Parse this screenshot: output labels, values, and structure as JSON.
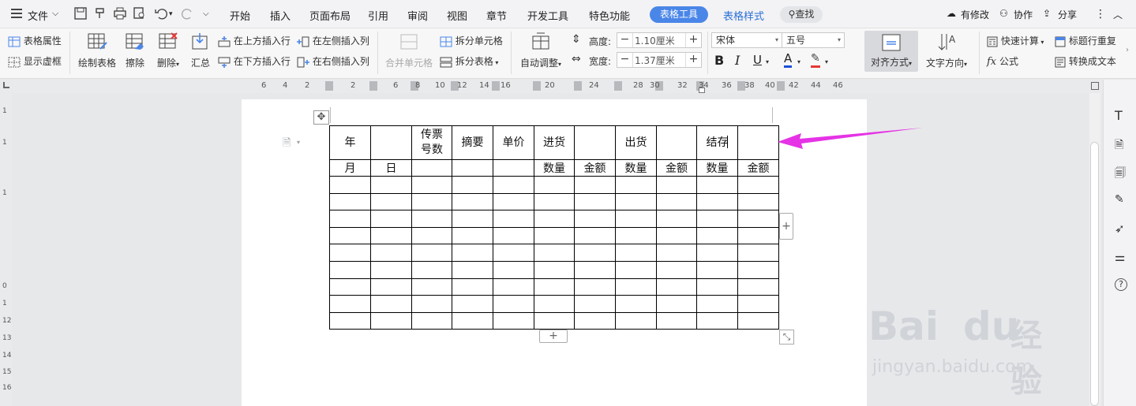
{
  "menu": {
    "file_label": "文件",
    "tabs": [
      "开始",
      "插入",
      "页面布局",
      "引用",
      "审阅",
      "视图",
      "章节",
      "开发工具",
      "特色功能"
    ],
    "active_tab": "表格工具",
    "extra_tab": "表格样式",
    "search_label": "查找",
    "right": {
      "modified": "有修改",
      "collab": "协作",
      "share": "分享"
    }
  },
  "ribbon": {
    "table_props": "表格属性",
    "show_gridlines": "显示虚框",
    "draw_table": "绘制表格",
    "erase": "擦除",
    "delete": "删除",
    "summary": "汇总",
    "insert_above": "在上方插入行",
    "insert_below": "在下方插入行",
    "insert_left": "在左侧插入列",
    "insert_right": "在右侧插入列",
    "merge_cells": "合并单元格",
    "split_cells": "拆分单元格",
    "split_table": "拆分表格",
    "auto_fit": "自动调整",
    "height_label": "高度:",
    "height_value": "1.10厘米",
    "width_label": "宽度:",
    "width_value": "1.37厘米",
    "font_name": "宋体",
    "font_size": "五号",
    "align": "对齐方式",
    "text_dir": "文字方向",
    "quick_calc": "快速计算",
    "repeat_header": "标题行重复",
    "formula": "公式",
    "to_text": "转换成文本",
    "colors": {
      "accent": "#4a86e8",
      "font_color": "#1d4ed8",
      "highlight": "#e53935"
    }
  },
  "ruler": {
    "numbers": [
      "6",
      "4",
      "2",
      "2",
      "6",
      "8",
      "10",
      "12",
      "14",
      "16",
      "20",
      "24",
      "28",
      "30",
      "32",
      "34",
      "36",
      "38",
      "40",
      "42",
      "44",
      "46"
    ],
    "vertical": [
      "1",
      "1",
      "1",
      "0",
      "1",
      "12",
      "13",
      "14",
      "15",
      "16"
    ]
  },
  "table": {
    "header_row1": [
      "年",
      "",
      "传票\n号数",
      "摘要",
      "单价",
      "进货",
      "",
      "出货",
      "",
      "结存",
      ""
    ],
    "header_row2": [
      "月",
      "日",
      "",
      "",
      "",
      "数量",
      "金额",
      "数量",
      "金额",
      "数量",
      "金额"
    ],
    "empty_rows": 9
  },
  "annotation": {
    "arrow_color": "#e533e5"
  },
  "watermark": {
    "brand": "Bai",
    "brand2": "du",
    "cn": "经验",
    "url": "jingyan.baidu.com"
  }
}
